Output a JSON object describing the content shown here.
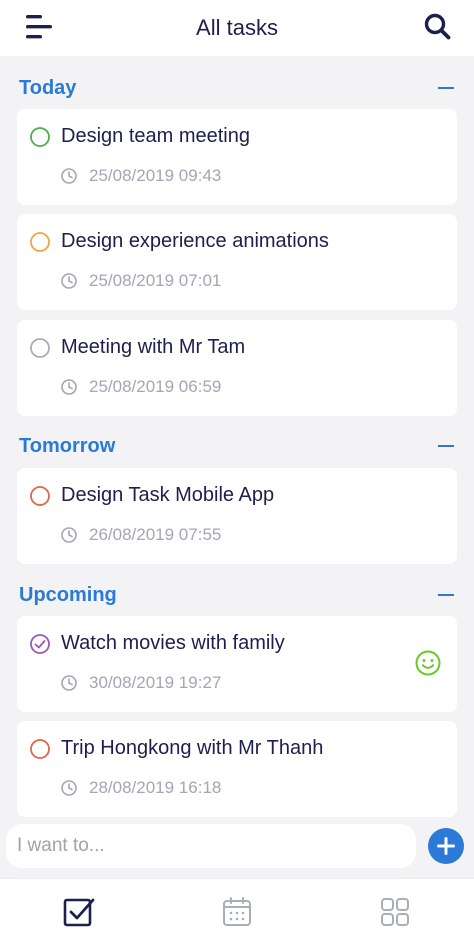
{
  "header": {
    "title": "All tasks",
    "menu_icon": "menu-icon",
    "search_icon": "search-icon"
  },
  "colors": {
    "accent": "#2a7ad6",
    "text": "#1d1f4d",
    "muted": "#a3a6b4",
    "green": "#4caf50",
    "orange": "#f0a63a",
    "gray": "#a9adb7",
    "red": "#e06648",
    "purple": "#9b59b6",
    "smile": "#6bc926"
  },
  "sections": [
    {
      "label": "Today",
      "tasks": [
        {
          "title": "Design team meeting",
          "time": "25/08/2019 09:43",
          "status_color": "green",
          "checked": false
        },
        {
          "title": "Design experience animations",
          "time": "25/08/2019 07:01",
          "status_color": "orange",
          "checked": false
        },
        {
          "title": "Meeting with Mr Tam",
          "time": "25/08/2019 06:59",
          "status_color": "gray",
          "checked": false
        }
      ]
    },
    {
      "label": "Tomorrow",
      "tasks": [
        {
          "title": "Design Task Mobile App",
          "time": "26/08/2019 07:55",
          "status_color": "red",
          "checked": false
        }
      ]
    },
    {
      "label": "Upcoming",
      "tasks": [
        {
          "title": "Watch movies with family",
          "time": "30/08/2019 19:27",
          "status_color": "purple",
          "checked": true,
          "mood_icon": "smile-icon"
        },
        {
          "title": "Trip Hongkong with Mr Thanh",
          "time": "28/08/2019 16:18",
          "status_color": "red",
          "checked": false
        }
      ]
    }
  ],
  "input": {
    "placeholder": "I want to...",
    "value": ""
  },
  "tabs": [
    {
      "name": "tasks",
      "icon": "checkbox-icon",
      "active": true
    },
    {
      "name": "calendar",
      "icon": "calendar-icon",
      "active": false
    },
    {
      "name": "categories",
      "icon": "grid-icon",
      "active": false
    }
  ]
}
